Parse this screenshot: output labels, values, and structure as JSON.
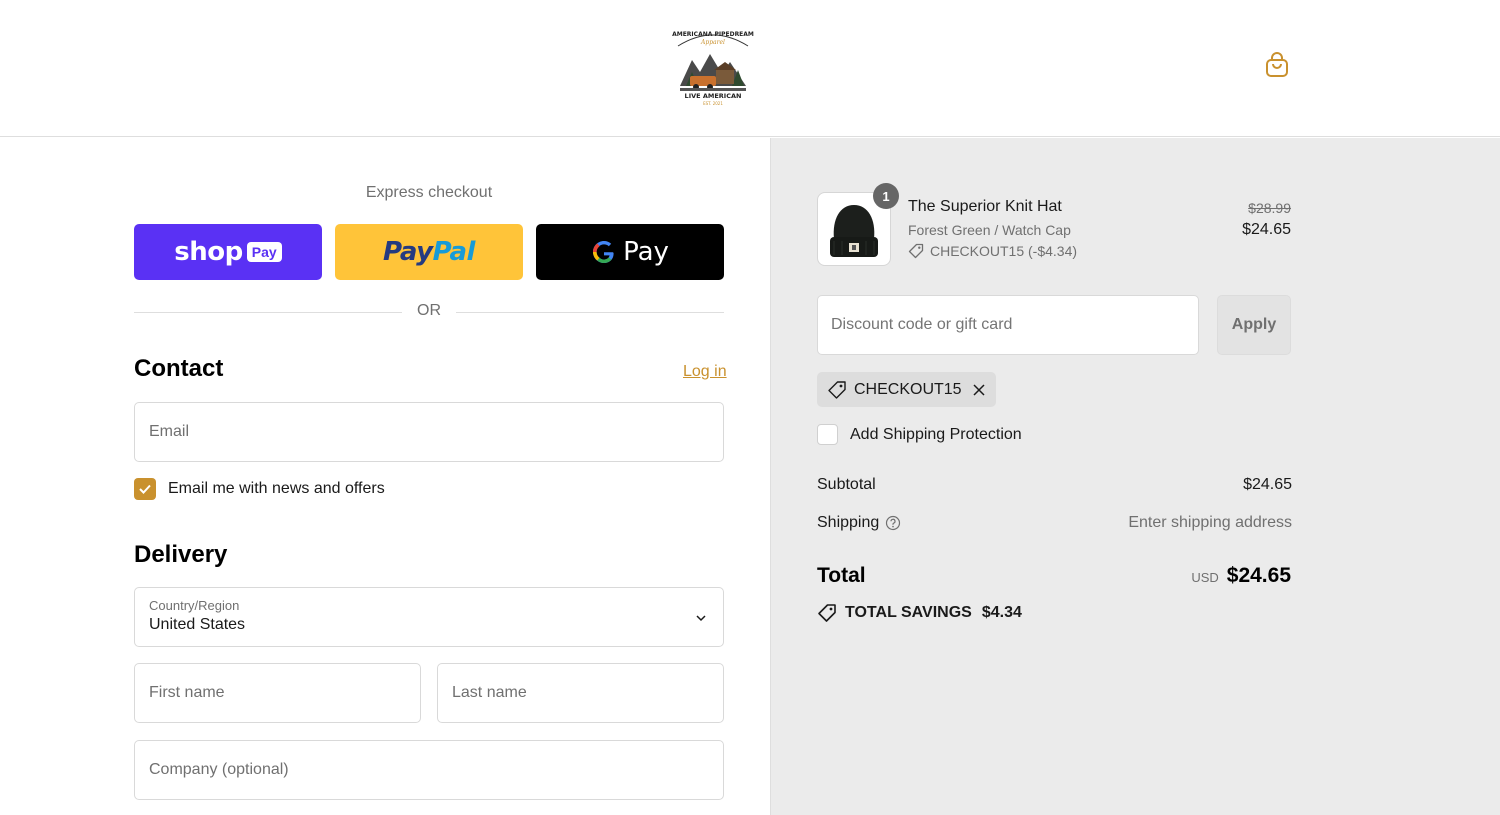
{
  "header": {
    "logo_text_top": "AMERICANA PIPEDREAM",
    "logo_text_script": "Apparel",
    "logo_text_bottom": "LIVE AMERICAN",
    "logo_text_est": "EST. 2021",
    "cart_icon": "shopping-bag-icon"
  },
  "express": {
    "title": "Express checkout",
    "shop_pay": {
      "word": "shop",
      "badge": "Pay"
    },
    "paypal": {
      "part1": "Pay",
      "part2": "Pal"
    },
    "gpay": {
      "g": "G",
      "word": "Pay"
    },
    "or": "OR"
  },
  "contact": {
    "title": "Contact",
    "login": "Log in",
    "email_placeholder": "Email",
    "news_label": "Email me with news and offers",
    "news_checked": true
  },
  "delivery": {
    "title": "Delivery",
    "country_label": "Country/Region",
    "country_value": "United States",
    "first_name_placeholder": "First name",
    "last_name_placeholder": "Last name",
    "company_placeholder": "Company (optional)"
  },
  "order": {
    "item": {
      "quantity": "1",
      "name": "The Superior Knit Hat",
      "variant": "Forest Green / Watch Cap",
      "discount": "CHECKOUT15 (-$4.34)",
      "original_price": "$28.99",
      "price": "$24.65"
    },
    "discount_placeholder": "Discount code or gift card",
    "apply_label": "Apply",
    "applied_code": "CHECKOUT15",
    "protection_label": "Add Shipping Protection",
    "subtotal_label": "Subtotal",
    "subtotal_value": "$24.65",
    "shipping_label": "Shipping",
    "shipping_value": "Enter shipping address",
    "total_label": "Total",
    "total_currency": "USD",
    "total_value": "$24.65",
    "savings_label": "TOTAL SAVINGS",
    "savings_value": "$4.34"
  },
  "colors": {
    "accent": "#c9912e",
    "shop_pay": "#5a31f4",
    "paypal": "#ffc439",
    "gpay": "#000000",
    "summary_bg": "#ebebeb"
  }
}
